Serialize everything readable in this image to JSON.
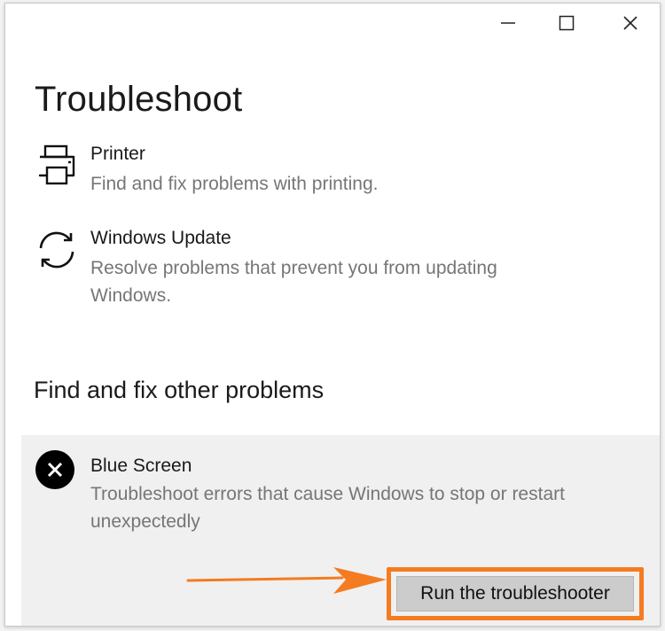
{
  "window": {
    "controls": {
      "minimize_icon": "minimize-icon",
      "maximize_icon": "maximize-icon",
      "close_icon": "close-icon"
    }
  },
  "page": {
    "title": "Troubleshoot"
  },
  "troubleshooters": [
    {
      "icon": "printer-icon",
      "name": "Printer",
      "description": "Find and fix problems with printing."
    },
    {
      "icon": "sync-icon",
      "name": "Windows Update",
      "description": "Resolve problems that prevent you from updating Windows."
    }
  ],
  "other": {
    "heading": "Find and fix other problems",
    "selected": {
      "icon": "error-x-icon",
      "name": "Blue Screen",
      "description": "Troubleshoot errors that cause Windows to stop or restart unexpectedly",
      "button_label": "Run the troubleshooter"
    }
  },
  "annotation": {
    "highlight_color": "#f47b20"
  }
}
